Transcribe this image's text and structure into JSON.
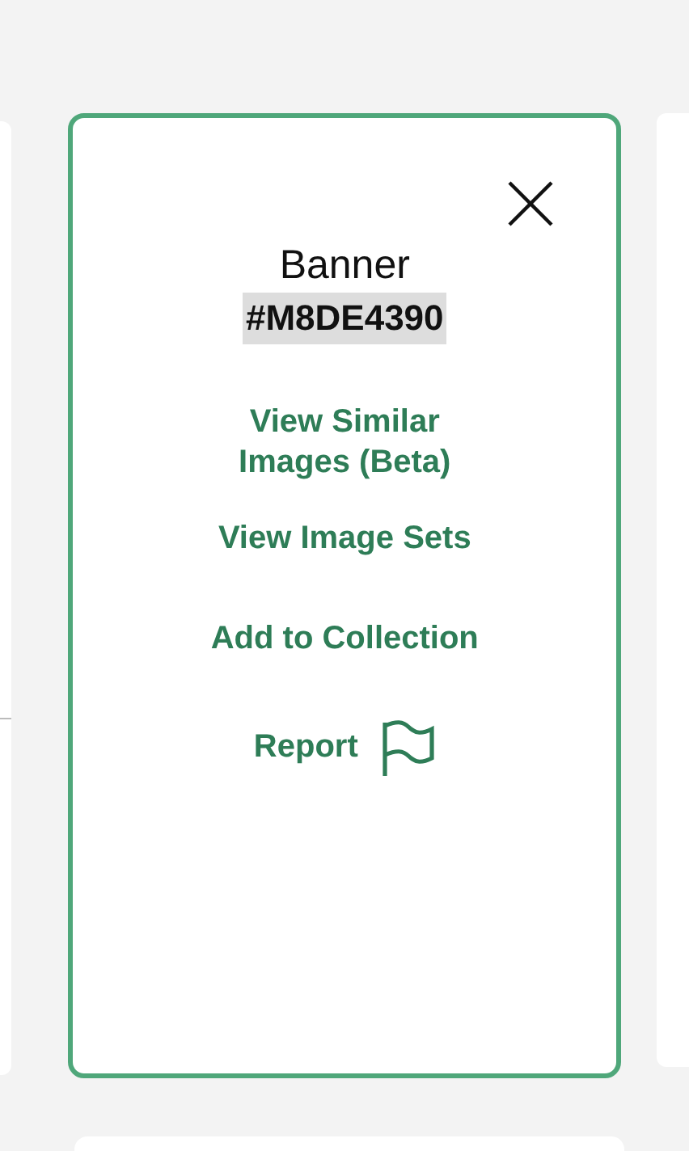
{
  "panel": {
    "title": "Banner",
    "code": "#M8DE4390",
    "actions": [
      {
        "label": "View Similar Images (Beta)",
        "kind": "link"
      },
      {
        "label": "View Image Sets",
        "kind": "link"
      },
      {
        "label": "Add to Collection",
        "kind": "link"
      },
      {
        "label": "Report",
        "kind": "flag"
      }
    ]
  }
}
